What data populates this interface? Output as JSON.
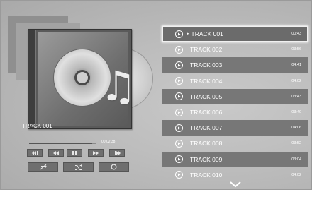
{
  "now_playing": {
    "title": "TRACK 001",
    "elapsed": "00:02:38",
    "progress_fraction": 0.94
  },
  "controls": {
    "row1": [
      "rewind-fast-icon",
      "previous-icon",
      "pause-icon",
      "next-icon",
      "fast-forward-fast-icon"
    ],
    "row2": [
      "repeat-off-icon",
      "shuffle-icon",
      "repeat-one-icon"
    ]
  },
  "tracks": [
    {
      "name": "TRACK 001",
      "duration": "00:43",
      "selected": true
    },
    {
      "name": "TRACK 002",
      "duration": "03:56",
      "selected": false
    },
    {
      "name": "TRACK 003",
      "duration": "04:41",
      "selected": false
    },
    {
      "name": "TRACK 004",
      "duration": "04:02",
      "selected": false
    },
    {
      "name": "TRACK 005",
      "duration": "03:43",
      "selected": false
    },
    {
      "name": "TRACK 006",
      "duration": "03:40",
      "selected": false
    },
    {
      "name": "TRACK 007",
      "duration": "04:06",
      "selected": false
    },
    {
      "name": "TRACK 008",
      "duration": "03:52",
      "selected": false
    },
    {
      "name": "TRACK 009",
      "duration": "03:04",
      "selected": false
    },
    {
      "name": "TRACK 010",
      "duration": "04:02",
      "selected": false
    }
  ]
}
